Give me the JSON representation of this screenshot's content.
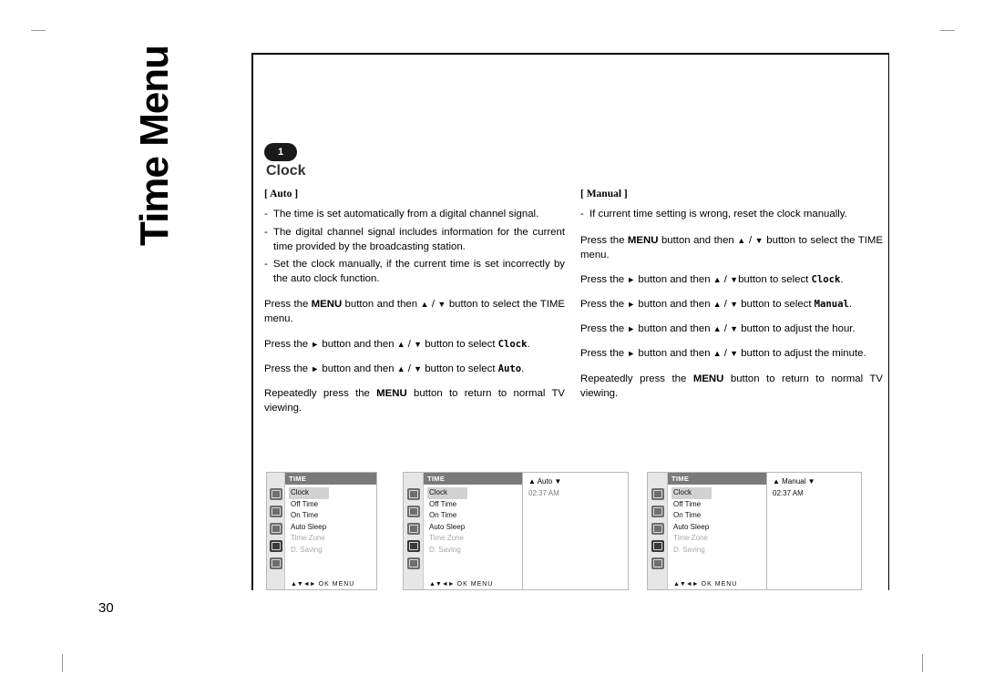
{
  "page_number": "30",
  "side_title": "Time Menu",
  "section": {
    "badge": "1",
    "title": "Clock"
  },
  "left_column": {
    "heading": "[ Auto ]",
    "bullets": [
      "The time is set automatically from a digital channel signal.",
      "The digital channel signal includes information for the current time provided by the broadcasting station.",
      "Set the clock manually, if the current time is set incorrectly by the auto clock function."
    ],
    "paragraphs": [
      {
        "parts": [
          {
            "t": "Press the ",
            "s": "n"
          },
          {
            "t": "MENU",
            "s": "b"
          },
          {
            "t": " button and then ",
            "s": "n"
          },
          {
            "t": "▲",
            "s": "tri"
          },
          {
            "t": " / ",
            "s": "n"
          },
          {
            "t": "▼",
            "s": "tri"
          },
          {
            "t": " button to select the TIME menu.",
            "s": "n"
          }
        ]
      },
      {
        "parts": [
          {
            "t": "Press the ",
            "s": "n"
          },
          {
            "t": "►",
            "s": "arr"
          },
          {
            "t": "  button and then ",
            "s": "n"
          },
          {
            "t": "▲",
            "s": "tri"
          },
          {
            "t": " / ",
            "s": "n"
          },
          {
            "t": "▼",
            "s": "tri"
          },
          {
            "t": " button to select ",
            "s": "n"
          },
          {
            "t": "Clock",
            "s": "m"
          },
          {
            "t": ".",
            "s": "n"
          }
        ]
      },
      {
        "parts": [
          {
            "t": "Press the ",
            "s": "n"
          },
          {
            "t": "►",
            "s": "arr"
          },
          {
            "t": " button and then ",
            "s": "n"
          },
          {
            "t": "▲",
            "s": "tri"
          },
          {
            "t": " / ",
            "s": "n"
          },
          {
            "t": "▼",
            "s": "tri"
          },
          {
            "t": " button to select ",
            "s": "n"
          },
          {
            "t": "Auto",
            "s": "m"
          },
          {
            "t": ".",
            "s": "n"
          }
        ]
      },
      {
        "parts": [
          {
            "t": "Repeatedly press the ",
            "s": "n"
          },
          {
            "t": "MENU",
            "s": "b"
          },
          {
            "t": " button to return to normal TV viewing.",
            "s": "n"
          }
        ]
      }
    ]
  },
  "right_column": {
    "heading": "[ Manual ]",
    "bullets": [
      "If current time setting is wrong, reset the clock manually."
    ],
    "paragraphs": [
      {
        "parts": [
          {
            "t": "Press the ",
            "s": "n"
          },
          {
            "t": "MENU",
            "s": "b"
          },
          {
            "t": " button and then ",
            "s": "n"
          },
          {
            "t": "▲",
            "s": "tri"
          },
          {
            "t": " / ",
            "s": "n"
          },
          {
            "t": "▼",
            "s": "tri"
          },
          {
            "t": " button to select the TIME menu.",
            "s": "n"
          }
        ]
      },
      {
        "parts": [
          {
            "t": "Press the ",
            "s": "n"
          },
          {
            "t": "►",
            "s": "arr"
          },
          {
            "t": " button and then ",
            "s": "n"
          },
          {
            "t": "▲",
            "s": "tri"
          },
          {
            "t": " / ",
            "s": "n"
          },
          {
            "t": "▼",
            "s": "tri"
          },
          {
            "t": "button to select ",
            "s": "n"
          },
          {
            "t": "Clock",
            "s": "m"
          },
          {
            "t": ".",
            "s": "n"
          }
        ]
      },
      {
        "parts": [
          {
            "t": "Press the ",
            "s": "n"
          },
          {
            "t": "►",
            "s": "arr"
          },
          {
            "t": "  button and then ",
            "s": "n"
          },
          {
            "t": "▲",
            "s": "tri"
          },
          {
            "t": " / ",
            "s": "n"
          },
          {
            "t": "▼",
            "s": "tri"
          },
          {
            "t": " button to select ",
            "s": "n"
          },
          {
            "t": "Manual",
            "s": "m"
          },
          {
            "t": ".",
            "s": "n"
          }
        ]
      },
      {
        "parts": [
          {
            "t": "Press the ",
            "s": "n"
          },
          {
            "t": "►",
            "s": "arr"
          },
          {
            "t": " button and then ",
            "s": "n"
          },
          {
            "t": "▲",
            "s": "tri"
          },
          {
            "t": " / ",
            "s": "n"
          },
          {
            "t": "▼",
            "s": "tri"
          },
          {
            "t": " button to adjust the hour.",
            "s": "n"
          }
        ]
      },
      {
        "parts": [
          {
            "t": "Press the ",
            "s": "n"
          },
          {
            "t": "►",
            "s": "arr"
          },
          {
            "t": " button and then ",
            "s": "n"
          },
          {
            "t": "▲",
            "s": "tri"
          },
          {
            "t": " / ",
            "s": "n"
          },
          {
            "t": "▼",
            "s": "tri"
          },
          {
            "t": " button to adjust the minute.",
            "s": "n"
          }
        ]
      },
      {
        "parts": [
          {
            "t": "Repeatedly press the ",
            "s": "n"
          },
          {
            "t": "MENU",
            "s": "b"
          },
          {
            "t": " button to return to normal TV viewing.",
            "s": "n"
          }
        ]
      }
    ]
  },
  "osd_common": {
    "title": "TIME",
    "items": [
      {
        "label": "Clock",
        "dim": false
      },
      {
        "label": "Off Time",
        "dim": false
      },
      {
        "label": "On Time",
        "dim": false
      },
      {
        "label": "Auto Sleep",
        "dim": false
      },
      {
        "label": "Time Zone",
        "dim": true
      },
      {
        "label": "D. Saving",
        "dim": true
      }
    ],
    "footer_nav": "▲▼◄►",
    "footer_ok": "OK",
    "footer_menu": "MENU"
  },
  "osd_panels": [
    {
      "name": "osd-time-menu",
      "highlight": "Clock",
      "panel": null
    },
    {
      "name": "osd-clock-auto",
      "highlight": "Clock",
      "panel": {
        "mode": "▲ Auto ▼",
        "time": "02:37   AM",
        "time_dim": true
      }
    },
    {
      "name": "osd-clock-manual",
      "highlight": "Clock",
      "panel": {
        "mode": "▲ Manual ▼",
        "time": "02:37   AM",
        "time_dim": false
      }
    }
  ]
}
